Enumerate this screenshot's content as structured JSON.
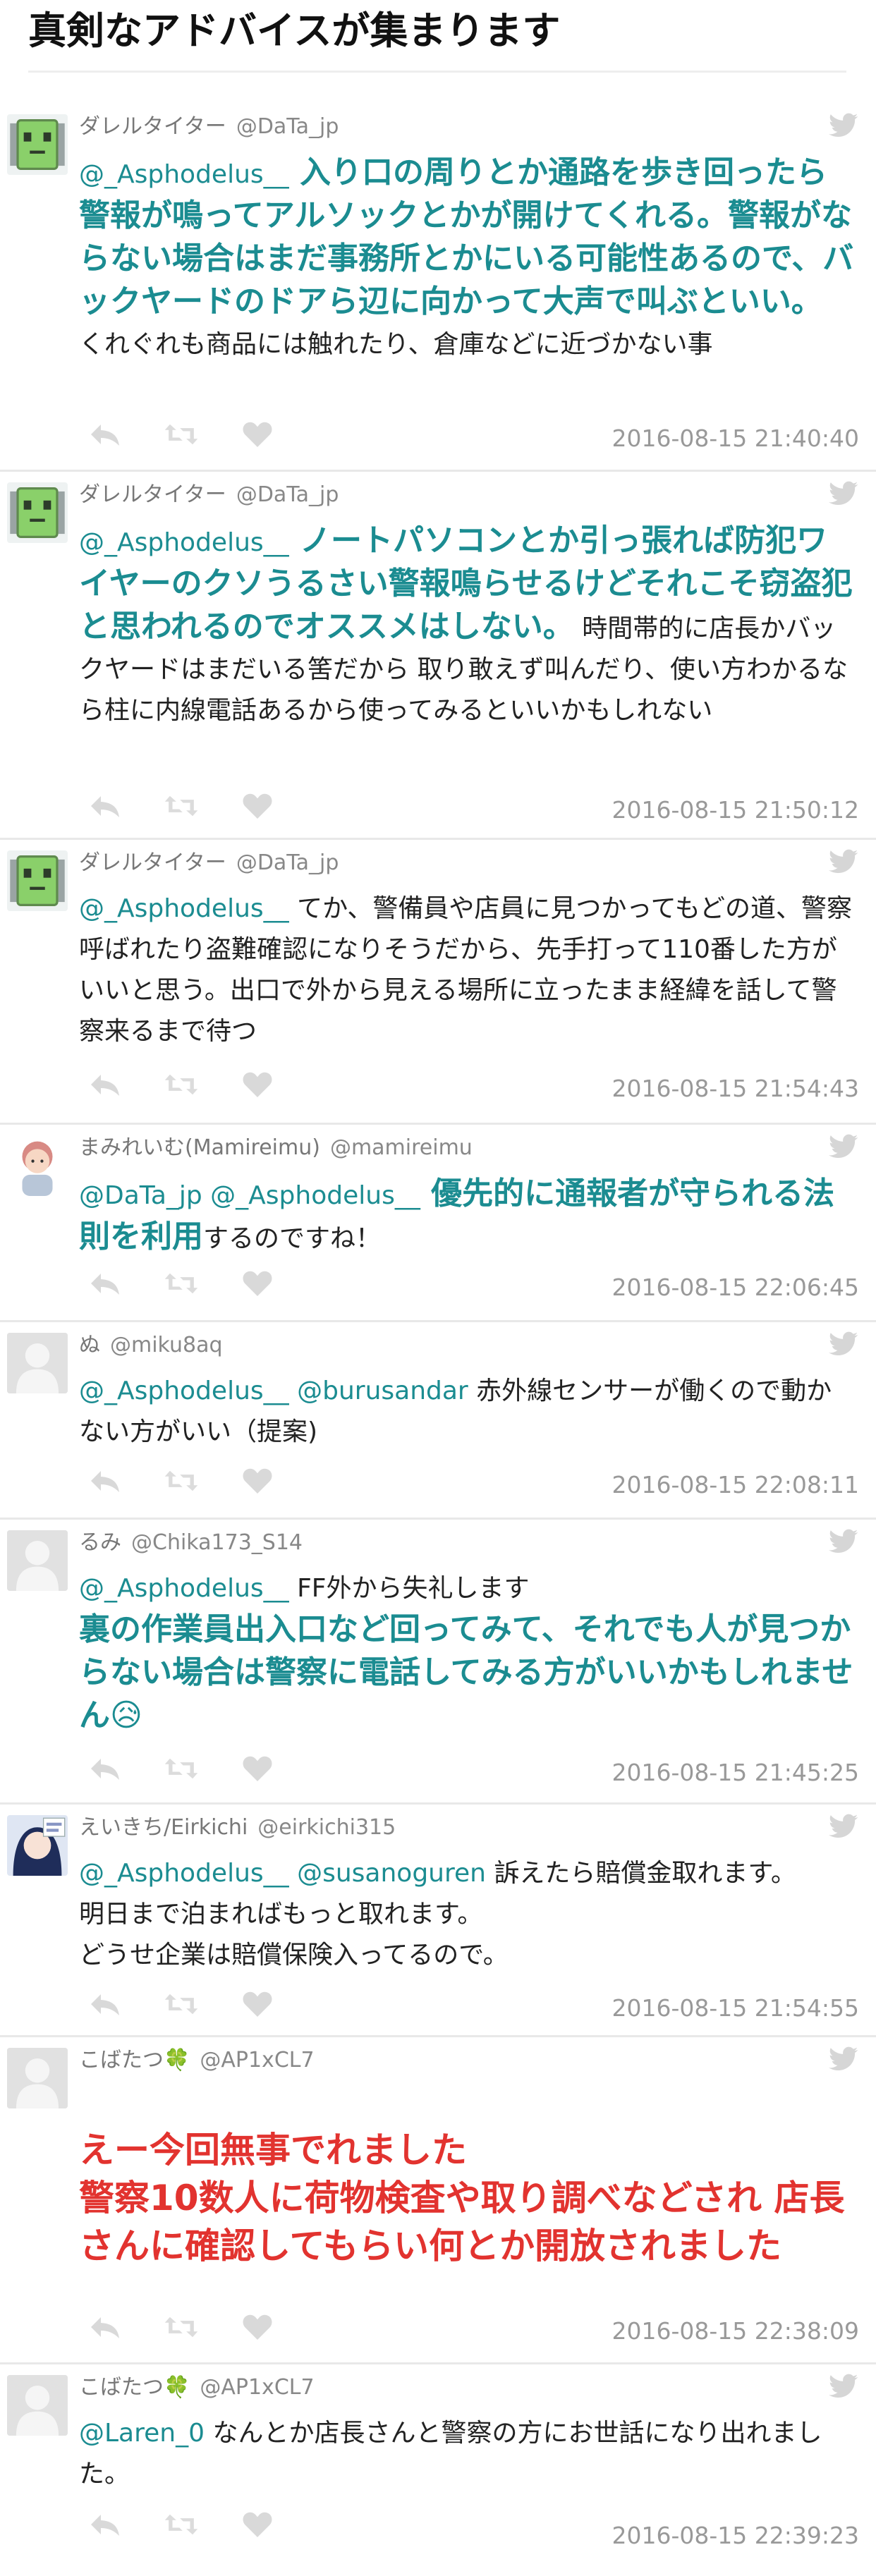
{
  "page_title": "真剣なアドバイスが集まります",
  "tweets": [
    {
      "name": "ダレルタイター",
      "handle": "@DaTa_jp",
      "mention1": "@_Asphodelus__",
      "highlight": " 入り口の周りとか通路を歩き回ったら警報が鳴ってアルソックとかが開けてくれる。警報がならない場合はまだ事務所とかにいる可能性あるので、バックヤードのドアら辺に向かって大声で叫ぶといい。",
      "text": "くれぐれも商品には触れたり、倉庫などに近づかない事",
      "timestamp": "2016-08-15 21:40:40"
    },
    {
      "name": "ダレルタイター",
      "handle": "@DaTa_jp",
      "mention1": "@_Asphodelus__",
      "highlight": " ノートパソコンとか引っ張れば防犯ワイヤーのクソうるさい警報鳴らせるけどそれこそ窃盗犯と思われるのでオススメはしない。",
      "text": "時間帯的に店長かバックヤードはまだいる筈だから 取り敢えず叫んだり、使い方わかるなら柱に内線電話あるから使ってみるといいかもしれない",
      "timestamp": "2016-08-15 21:50:12"
    },
    {
      "name": "ダレルタイター",
      "handle": "@DaTa_jp",
      "mention1": "@_Asphodelus__",
      "text": " てか、警備員や店員に見つかってもどの道、警察呼ばれたり盗難確認になりそうだから、先手打って110番した方がいいと思う。出口で外から見える場所に立ったまま経緯を話して警察来るまで待つ",
      "timestamp": "2016-08-15 21:54:43"
    },
    {
      "name": "まみれいむ(Mamireimu)",
      "handle": "@mamireimu",
      "mention1": "@DaTa_jp @_Asphodelus__",
      "highlight": " 優先的に通報者が守られる法則を利用",
      "text": "するのですね！",
      "timestamp": "2016-08-15 22:06:45"
    },
    {
      "name": "ぬ",
      "handle": "@miku8aq",
      "mention1": "@_Asphodelus__",
      "mention2": " @burusandar",
      "text": " 赤外線センサーが働くので動かない方がいい（提案)",
      "timestamp": "2016-08-15 22:08:11"
    },
    {
      "name": "るみ",
      "handle": "@Chika173_S14",
      "mention1": "@_Asphodelus__",
      "text": " FF外から失礼します",
      "highlight": "裏の作業員出入口など回ってみて、それでも人が見つからない場合は警察に電話してみる方がいいかもしれません😥",
      "timestamp": "2016-08-15 21:45:25"
    },
    {
      "name": "えいきち/Eirkichi",
      "handle": "@eirkichi315",
      "mention1": "@_Asphodelus__",
      "mention2": " @susanoguren",
      "text": " 訴えたら賠償金取れます。",
      "text2": "明日まで泊まればもっと取れます。",
      "text3": "どうせ企業は賠償保険入ってるので。",
      "timestamp": "2016-08-15 21:54:55"
    },
    {
      "name": "こばたつ🍀",
      "handle": "@AP1xCL7",
      "red_text": "えー今回無事でれました\n警察10数人に荷物検査や取り調べなどされ 店長さんに確認してもらい何とか開放されました",
      "timestamp": "2016-08-15 22:38:09"
    },
    {
      "name": "こばたつ🍀",
      "handle": "@AP1xCL7",
      "mention1": "@Laren_0",
      "text": " なんとか店長さんと警察の方にお世話になり出れました。",
      "timestamp": "2016-08-15 22:39:23"
    }
  ],
  "icons": {
    "bird": "twitter-bird-icon",
    "reply": "reply-icon",
    "retweet": "retweet-icon",
    "like": "like-icon"
  },
  "colors": {
    "mention": "#1b8c91",
    "red": "#e2332f",
    "meta": "#999999"
  }
}
